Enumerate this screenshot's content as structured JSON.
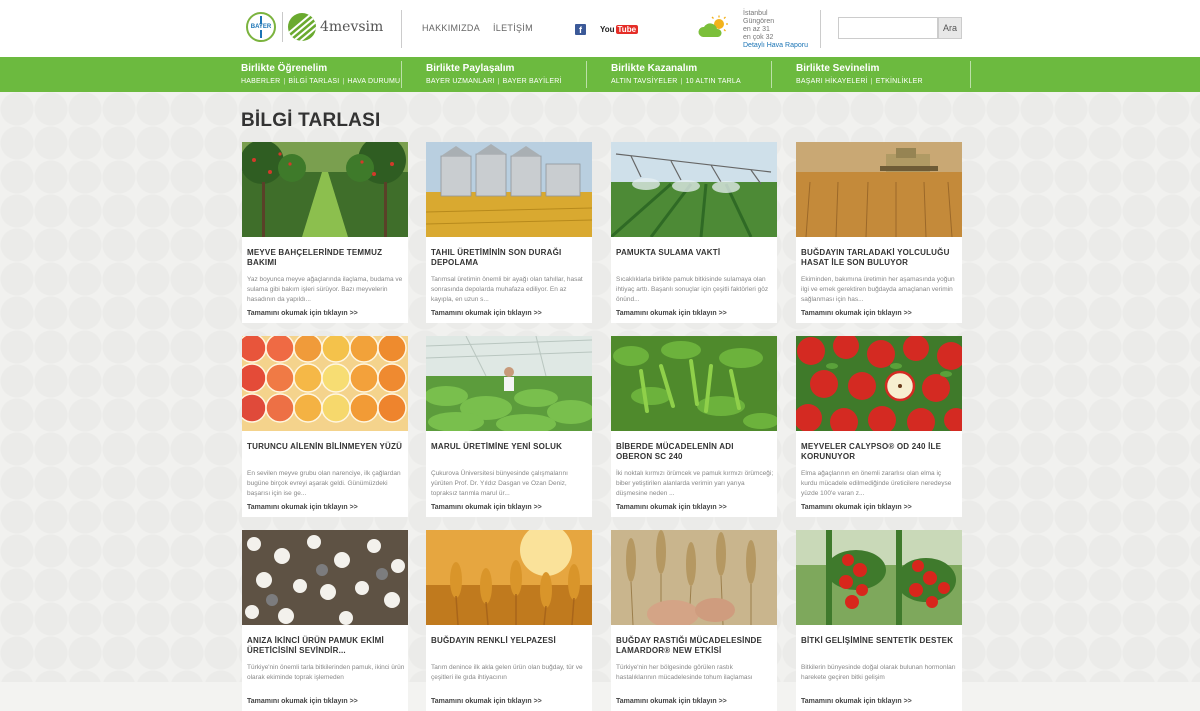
{
  "header": {
    "bayer_logo_text": "BAYER",
    "brand_name": "4mevsim",
    "nav": [
      "HAKKIMIZDA",
      "İLETİŞİM"
    ],
    "social": {
      "facebook": "f",
      "youtube_you": "You",
      "youtube_tube": "Tube"
    },
    "weather": {
      "city": "İstanbul",
      "district": "Güngören",
      "min": "en az 31",
      "max": "en çok 32",
      "link": "Detaylı Hava Raporu"
    },
    "search": {
      "placeholder": "",
      "button": "Ara"
    }
  },
  "menu": [
    {
      "title": "Birlikte Öğrenelim",
      "subs": [
        "HABERLER",
        "BİLGİ TARLASI",
        "HAVA DURUMU"
      ]
    },
    {
      "title": "Birlikte Paylaşalım",
      "subs": [
        "BAYER UZMANLARI",
        "BAYER BAYİLERİ"
      ]
    },
    {
      "title": "Birlikte Kazanalım",
      "subs": [
        "ALTIN TAVSİYELER",
        "10 ALTIN TARLA"
      ]
    },
    {
      "title": "Birlikte Sevinelim",
      "subs": [
        "BAŞARI HİKAYELERİ",
        "ETKİNLİKLER"
      ]
    }
  ],
  "page": {
    "title": "BİLGİ TARLASI"
  },
  "read_more": "Tamamını okumak için tıklayın >>",
  "cards": [
    {
      "title": "MEYVE BAHÇELERİNDE TEMMUZ BAKIMI",
      "text": "Yaz boyunca meyve ağaçlarında ilaçlama, budama ve sulama gibi bakım işleri sürüyor. Bazı meyvelerin hasadının da yapıldı..."
    },
    {
      "title": "TAHIL ÜRETİMİNİN SON DURAĞI DEPOLAMA",
      "text": "Tarımsal üretimin önemli bir ayağı olan tahıllar, hasat sonrasında depolarda muhafaza ediliyor. En az kayıpla, en uzun s..."
    },
    {
      "title": "PAMUKTA SULAMA VAKTİ",
      "text": "Sıcaklıklarla birlikte pamuk bitkisinde sulamaya olan ihtiyaç arttı. Başarılı sonuçlar için çeşitli faktörleri göz önünd..."
    },
    {
      "title": "BUĞDAYIN TARLADAKİ YOLCULUĞU HASAT İLE SON BULUYOR",
      "text": "Ekiminden, bakımına üretimin her aşamasında yoğun ilgi ve emek gerektiren buğdayda amaçlanan verimin sağlanması için has..."
    },
    {
      "title": "TURUNCU AİLENİN BİLİNMEYEN YÜZÜ",
      "text": "En sevilen meyve grubu olan narenciye, ilk çağlardan bugüne birçok evreyi aşarak geldi. Günümüzdeki başarısı için ise ge..."
    },
    {
      "title": "MARUL ÜRETİMİNE YENİ SOLUK",
      "text": "Çukurova Üniversitesi bünyesinde çalışmalarını yürüten Prof. Dr. Yıldız Dasgan ve Ozan Deniz, topraksız tarımla marul ür..."
    },
    {
      "title": "BİBERDE MÜCADELENİN ADI OBERON SC 240",
      "text": "İki noktalı kırmızı örümcek ve pamuk kırmızı örümceği; biber yetiştirilen alanlarda verimin yarı yarıya düşmesine neden ..."
    },
    {
      "title": "MEYVELER CALYPSO® OD 240 İLE KORUNUYOR",
      "text": "Elma ağaçlarının en önemli zararlısı olan elma iç kurdu mücadele edilmediğinde üreticilere neredeyse yüzde 100'e varan z..."
    },
    {
      "title": "ANIZA İKİNCİ ÜRÜN PAMUK EKİMİ ÜRETİCİSİNİ SEVİNDİR...",
      "text": "Türkiye'nin önemli tarla bitkilerinden pamuk, ikinci ürün olarak ekiminde toprak işlemeden"
    },
    {
      "title": "BUĞDAYIN RENKLİ YELPAZESİ",
      "text": "Tarım denince ilk akla gelen ürün olan buğday, tür ve çeşitleri ile gıda ihtiyacının"
    },
    {
      "title": "BUĞDAY RASTIĞI MÜCADELESİNDE LAMARDOR® NEW ETKİSİ",
      "text": "Türkiye'nin her bölgesinde görülen rastık hastalıklarının mücadelesinde tohum ilaçlaması"
    },
    {
      "title": "BİTKİ GELİŞİMİNE SENTETİK DESTEK",
      "text": "Bitkilerin bünyesinde doğal olarak bulunan hormonları harekete geçiren bitki gelişim"
    }
  ]
}
